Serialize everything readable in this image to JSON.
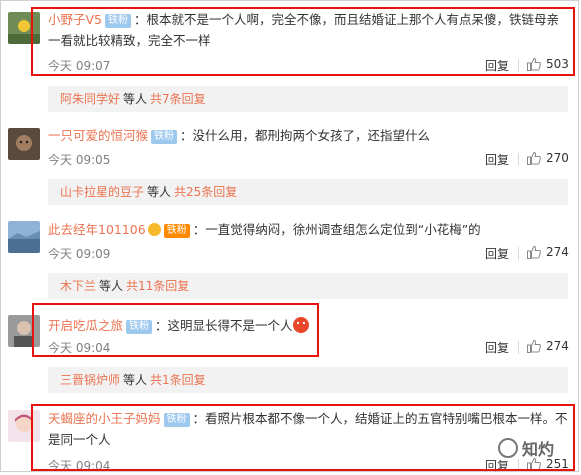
{
  "comments": [
    {
      "username": "小野子V5",
      "badge": "铁粉",
      "text": "：根本就不是一个人啊，完全不像，而且结婚证上那个人有点呆傻，铁链母亲一看就比较精致，完全不一样",
      "time": "今天 09:07",
      "reply_label": "回复",
      "likes": "503"
    },
    {
      "username": "一只可爱的恒河猴",
      "badge": "铁粉",
      "text": "：没什么用，都刑拘两个女孩了，还指望什么",
      "time": "今天 09:05",
      "reply_label": "回复",
      "likes": "270"
    },
    {
      "username": "此去经年101106",
      "badge": "铁粉",
      "text": "：一直觉得纳闷，徐州调查组怎么定位到“小花梅”的",
      "time": "今天 09:09",
      "reply_label": "回复",
      "likes": "274"
    },
    {
      "username": "开启吃瓜之旅",
      "badge": "铁粉",
      "text": "：这明显长得不是一个人",
      "time": "今天 09:04",
      "reply_label": "回复",
      "likes": "274"
    },
    {
      "username": "天蝎座的小王子妈妈",
      "badge": "铁粉",
      "text": "：看照片根本都不像一个人，结婚证上的五官特别嘴巴根本一样。不是同一个人",
      "time": "今天 09:04",
      "reply_label": "回复",
      "likes": "251"
    }
  ],
  "threads": [
    {
      "name": "阿朱同学好",
      "mid": "等人",
      "count": "共7条回复"
    },
    {
      "name": "山卡拉星的豆子",
      "mid": "等人",
      "count": "共25条回复"
    },
    {
      "name": "木下兰",
      "mid": "等人",
      "count": "共11条回复"
    },
    {
      "name": "三晋锅炉师",
      "mid": "等人",
      "count": "共1条回复"
    }
  ],
  "watermark": "知灼",
  "colors": {
    "username": "#eb7350",
    "highlight_box": "#e8130b",
    "fan_badge": "#9ec9ee",
    "thread_bg": "#f2f2f2"
  }
}
